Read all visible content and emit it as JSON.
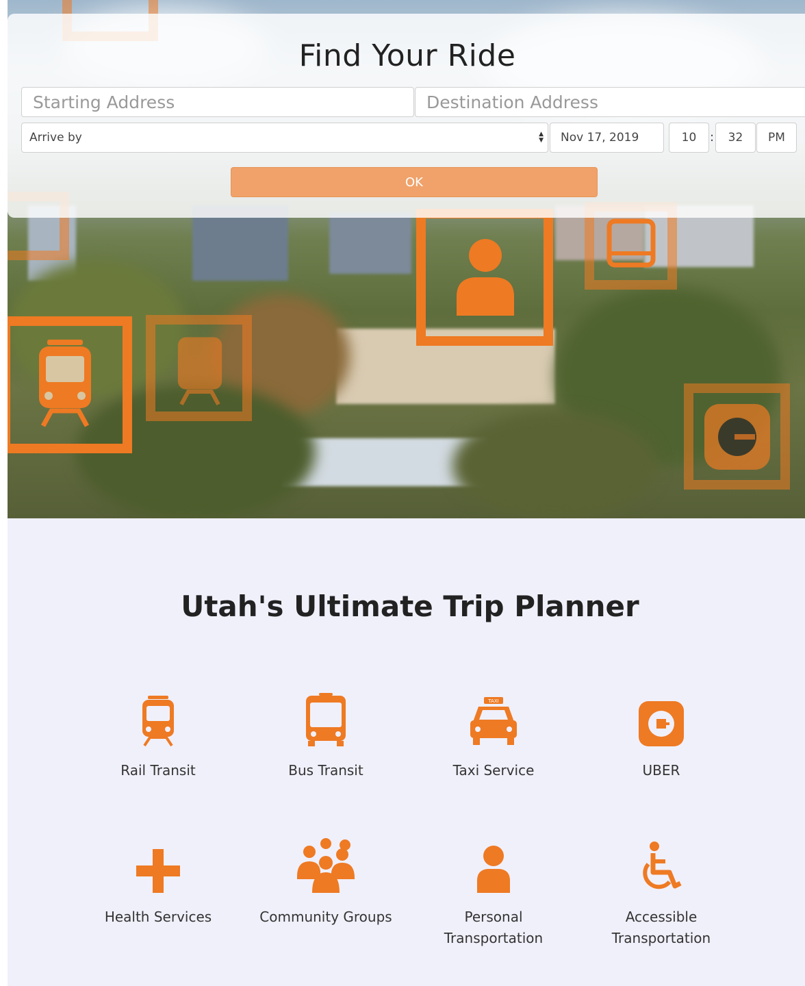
{
  "form": {
    "title": "Find Your Ride",
    "start_placeholder": "Starting Address",
    "destination_placeholder": "Destination Address",
    "mode_selected": "Arrive by",
    "date": "Nov 17, 2019",
    "hour": "10",
    "minute": "32",
    "time_separator": ":",
    "ampm": "PM",
    "ok_label": "OK"
  },
  "section": {
    "title": "Utah's Ultimate Trip Planner"
  },
  "services": [
    {
      "label": "Rail Transit",
      "icon": "train-icon"
    },
    {
      "label": "Bus Transit",
      "icon": "bus-icon"
    },
    {
      "label": "Taxi Service",
      "icon": "taxi-icon",
      "badge": "TAXI"
    },
    {
      "label": "UBER",
      "icon": "uber-icon"
    },
    {
      "label": "Health Services",
      "icon": "plus-icon"
    },
    {
      "label": "Community Groups",
      "icon": "group-icon"
    },
    {
      "label": "Personal Transportation",
      "icon": "person-icon"
    },
    {
      "label": "Accessible Transportation",
      "icon": "wheelchair-icon"
    }
  ],
  "colors": {
    "accent": "#ee7a23",
    "button": "#f0a26a",
    "section_bg": "#f0f0fb"
  }
}
